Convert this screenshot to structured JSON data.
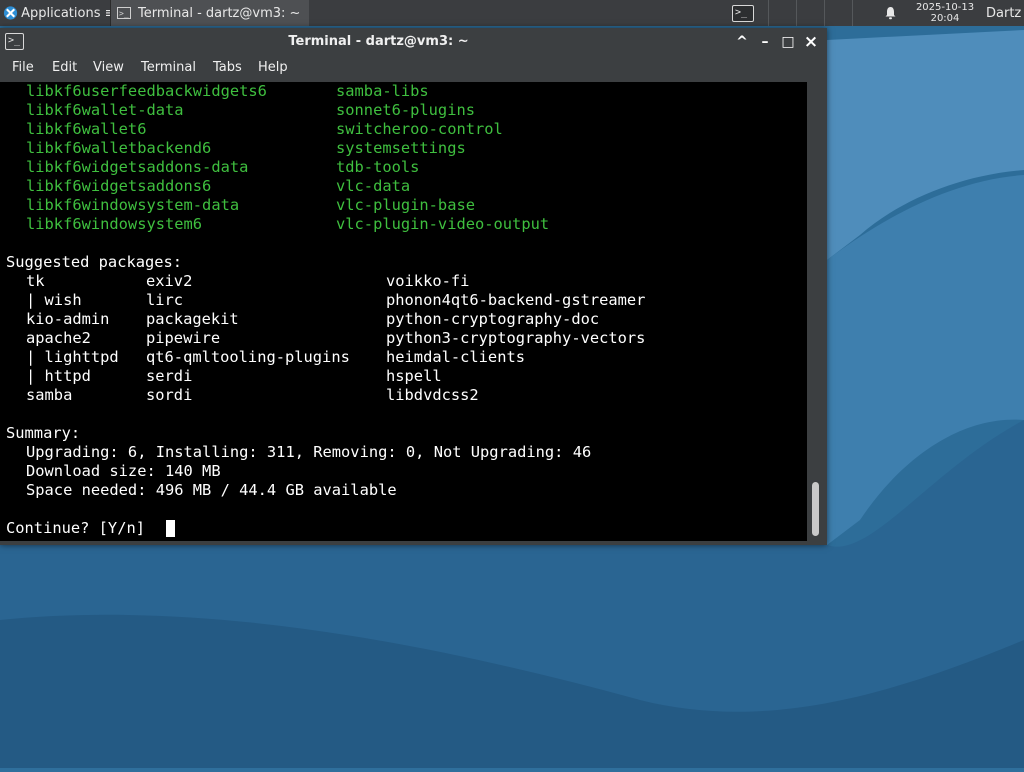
{
  "panel": {
    "apps_label": "Applications ≡",
    "task_label": "Terminal - dartz@vm3: ~",
    "launcher_icon": "terminal-icon",
    "bell_icon": "bell-icon",
    "clock": {
      "date": "2025-10-13",
      "time": "20:04"
    },
    "user": "Dartz"
  },
  "window": {
    "title": "Terminal - dartz@vm3: ~",
    "buttons": {
      "shade": "^",
      "minimize": "–",
      "maximize": "□",
      "close": "×"
    },
    "menu": [
      "File",
      "Edit",
      "View",
      "Terminal",
      "Tabs",
      "Help"
    ]
  },
  "terminal": {
    "green_rows": [
      [
        "libkf6userfeedbackwidgets6",
        "samba-libs"
      ],
      [
        "libkf6wallet-data",
        "sonnet6-plugins"
      ],
      [
        "libkf6wallet6",
        "switcheroo-control"
      ],
      [
        "libkf6walletbackend6",
        "systemsettings"
      ],
      [
        "libkf6widgetsaddons-data",
        "tdb-tools"
      ],
      [
        "libkf6widgetsaddons6",
        "vlc-data"
      ],
      [
        "libkf6windowsystem-data",
        "vlc-plugin-base"
      ],
      [
        "libkf6windowsystem6",
        "vlc-plugin-video-output"
      ]
    ],
    "suggested_header": "Suggested packages:",
    "suggested_rows": [
      [
        "tk",
        "exiv2",
        "voikko-fi"
      ],
      [
        "| wish",
        "lirc",
        "phonon4qt6-backend-gstreamer"
      ],
      [
        "kio-admin",
        "packagekit",
        "python-cryptography-doc"
      ],
      [
        "apache2",
        "pipewire",
        "python3-cryptography-vectors"
      ],
      [
        "| lighttpd",
        "qt6-qmltooling-plugins",
        "heimdal-clients"
      ],
      [
        "| httpd",
        "serdi",
        "hspell"
      ],
      [
        "samba",
        "sordi",
        "libdvdcss2"
      ]
    ],
    "summary_header": "Summary:",
    "summary_lines": [
      "Upgrading: 6, Installing: 311, Removing: 0, Not Upgrading: 46",
      "Download size: 140 MB",
      "Space needed: 496 MB / 44.4 GB available"
    ],
    "prompt": "Continue? [Y/n] "
  }
}
